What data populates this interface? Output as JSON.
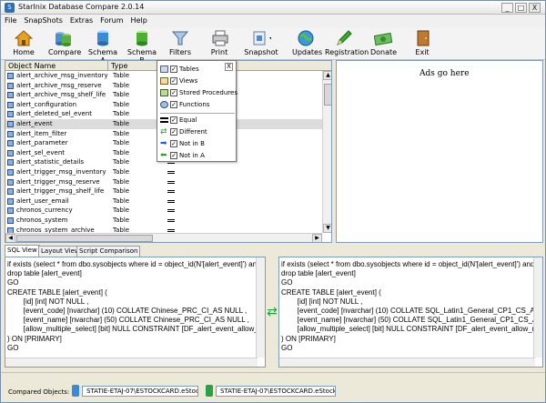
{
  "window": {
    "title": "StarInix Database Compare 2.0.14",
    "minimize": "_",
    "maximize": "□",
    "close": "X"
  },
  "menu": [
    "File",
    "SnapShots",
    "Extras",
    "Forum",
    "Help"
  ],
  "toolbar": [
    {
      "label": "Home",
      "icon": "home-icon"
    },
    {
      "label": "Compare",
      "icon": "compare-icon"
    },
    {
      "label": "Schema A",
      "icon": "database-icon"
    },
    {
      "label": "Schema B",
      "icon": "database-icon"
    },
    {
      "label": "Filters",
      "icon": "funnel-icon"
    },
    {
      "label": "Print",
      "icon": "printer-icon"
    },
    {
      "label": "Snapshot",
      "icon": "snapshot-icon"
    },
    {
      "label": "Updates",
      "icon": "globe-icon"
    },
    {
      "label": "Registration",
      "icon": "pencil-icon"
    },
    {
      "label": "Donate",
      "icon": "money-icon"
    },
    {
      "label": "Exit",
      "icon": "door-icon"
    }
  ],
  "grid": {
    "columns": [
      "Object Name",
      "Type"
    ],
    "rows": [
      {
        "name": "alert_archive_msg_inventory",
        "type": "Table"
      },
      {
        "name": "alert_archive_msg_reserve",
        "type": "Table"
      },
      {
        "name": "alert_archive_msg_shelf_life",
        "type": "Table"
      },
      {
        "name": "alert_configuration",
        "type": "Table"
      },
      {
        "name": "alert_deleted_sel_event",
        "type": "Table"
      },
      {
        "name": "alert_event",
        "type": "Table"
      },
      {
        "name": "alert_item_filter",
        "type": "Table"
      },
      {
        "name": "alert_parameter",
        "type": "Table"
      },
      {
        "name": "alert_sel_event",
        "type": "Table"
      },
      {
        "name": "alert_statistic_details",
        "type": "Table"
      },
      {
        "name": "alert_trigger_msg_inventory",
        "type": "Table"
      },
      {
        "name": "alert_trigger_msg_reserve",
        "type": "Table"
      },
      {
        "name": "alert_trigger_msg_shelf_life",
        "type": "Table"
      },
      {
        "name": "alert_user_email",
        "type": "Table"
      },
      {
        "name": "chronos_currency",
        "type": "Table"
      },
      {
        "name": "chronos_system",
        "type": "Table"
      },
      {
        "name": "chronos_system_archive",
        "type": "Table"
      }
    ],
    "selected_index": 5
  },
  "filter_popup": {
    "close": "X",
    "object_types": [
      "Tables",
      "Views",
      "Stored Procedures",
      "Functions"
    ],
    "compare_states": [
      "Equal",
      "Different",
      "Not in B",
      "Not in A"
    ]
  },
  "ads": {
    "text": "Ads go here"
  },
  "tabs": [
    "SQL View",
    "Layout View",
    "Script Comparison"
  ],
  "sql_left": "if exists (select * from dbo.sysobjects where id = object_id(N'[alert_event]') and C\ndrop table [alert_event]\nGO\nCREATE TABLE [alert_event] (\n        [id] [int] NOT NULL ,\n        [event_code] [nvarchar] (10) COLLATE Chinese_PRC_CI_AS NULL ,\n        [event_name] [nvarchar] (50) COLLATE Chinese_PRC_CI_AS NULL ,\n        [allow_multiple_select] [bit] NULL CONSTRAINT [DF_alert_event_allow_m\n) ON [PRIMARY]\nGO",
  "sql_right": "if exists (select * from dbo.sysobjects where id = object_id(N'[alert_event]') and C\ndrop table [alert_event]\nGO\nCREATE TABLE [alert_event] (\n        [id] [int] NOT NULL ,\n        [event_code] [nvarchar] (10) COLLATE SQL_Latin1_General_CP1_CS_A\n        [event_name] [nvarchar] (50) COLLATE SQL_Latin1_General_CP1_CS_A\n        [allow_multiple_select] [bit] NULL CONSTRAINT [DF_alert_event_allow_m\n) ON [PRIMARY]\nGO",
  "status": {
    "label": "Compared Objects:",
    "object_a": "STATIE-ETAJ-07\\ESTOCKCARD.eStock",
    "object_b": "STATIE-ETAJ-07\\ESTOCKCARD.eStock_"
  },
  "colors": {
    "window_bg": "#ece9d8",
    "selected_row": "#dcdcdc",
    "border": "#7f9db9"
  }
}
